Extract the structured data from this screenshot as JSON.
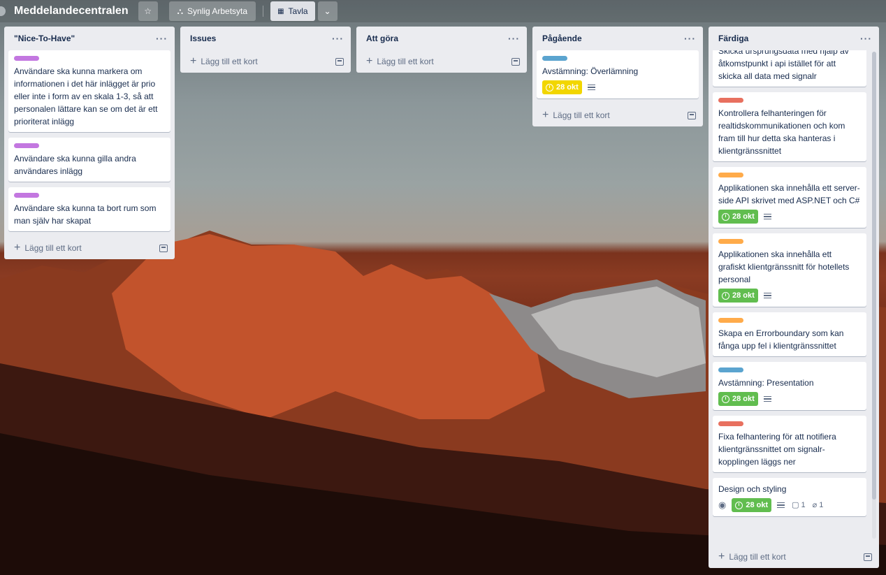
{
  "board": {
    "title": "Meddelandecentralen",
    "visibility_label": "Synlig Arbetsyta",
    "view_label": "Tavla"
  },
  "colors": {
    "purple": "#c377e0",
    "blue": "#5ba4cf",
    "red": "#e8705f",
    "orange": "#ffab4a",
    "yellow_badge": "#f2d600",
    "green_badge": "#61bd4f"
  },
  "add_card_label": "Lägg till ett kort",
  "lists": [
    {
      "title": "\"Nice-To-Have\"",
      "cards": [
        {
          "label_color": "purple",
          "text": "Användare ska kunna markera om informationen i det här inlägget är prio eller inte i form av en skala 1-3, så att personalen lättare kan se om det är ett prioriterat inlägg"
        },
        {
          "label_color": "purple",
          "text": "Användare ska kunna gilla andra användares inlägg"
        },
        {
          "label_color": "purple",
          "text": "Användare ska kunna ta bort rum som man själv har skapat"
        }
      ]
    },
    {
      "title": "Issues",
      "cards": []
    },
    {
      "title": "Att göra",
      "cards": []
    },
    {
      "title": "Pågående",
      "cards": [
        {
          "label_color": "blue",
          "text": "Avstämning: Överlämning",
          "due": "28 okt"
        }
      ]
    },
    {
      "title": "Färdiga",
      "cards": [
        {
          "text": "Skicka ursprungsdata med hjälp av åtkomstpunkt i api istället för att skicka all data med signalr"
        },
        {
          "label_color": "red",
          "text": "Kontrollera felhanteringen för realtidskommunikationen och kom fram till hur detta ska hanteras i klientgränssnittet"
        },
        {
          "label_color": "orange",
          "text": "Applikationen ska innehålla ett server-side API skrivet med ASP.NET och C#",
          "due": "28 okt"
        },
        {
          "label_color": "orange",
          "text": "Applikationen ska innehålla ett grafiskt klientgränssnitt för hotellets personal",
          "due": "28 okt"
        },
        {
          "label_color": "orange",
          "text": "Skapa en Errorboundary som kan fånga upp fel i klientgränssnittet"
        },
        {
          "label_color": "blue",
          "text": "Avstämning: Presentation",
          "due": "28 okt"
        },
        {
          "label_color": "red",
          "text": "Fixa felhantering för att notifiera klientgränssnittet om signalr-kopplingen läggs ner"
        },
        {
          "text": "Design och styling",
          "due": "28 okt",
          "comments": "1",
          "attachments": "1"
        }
      ]
    }
  ]
}
